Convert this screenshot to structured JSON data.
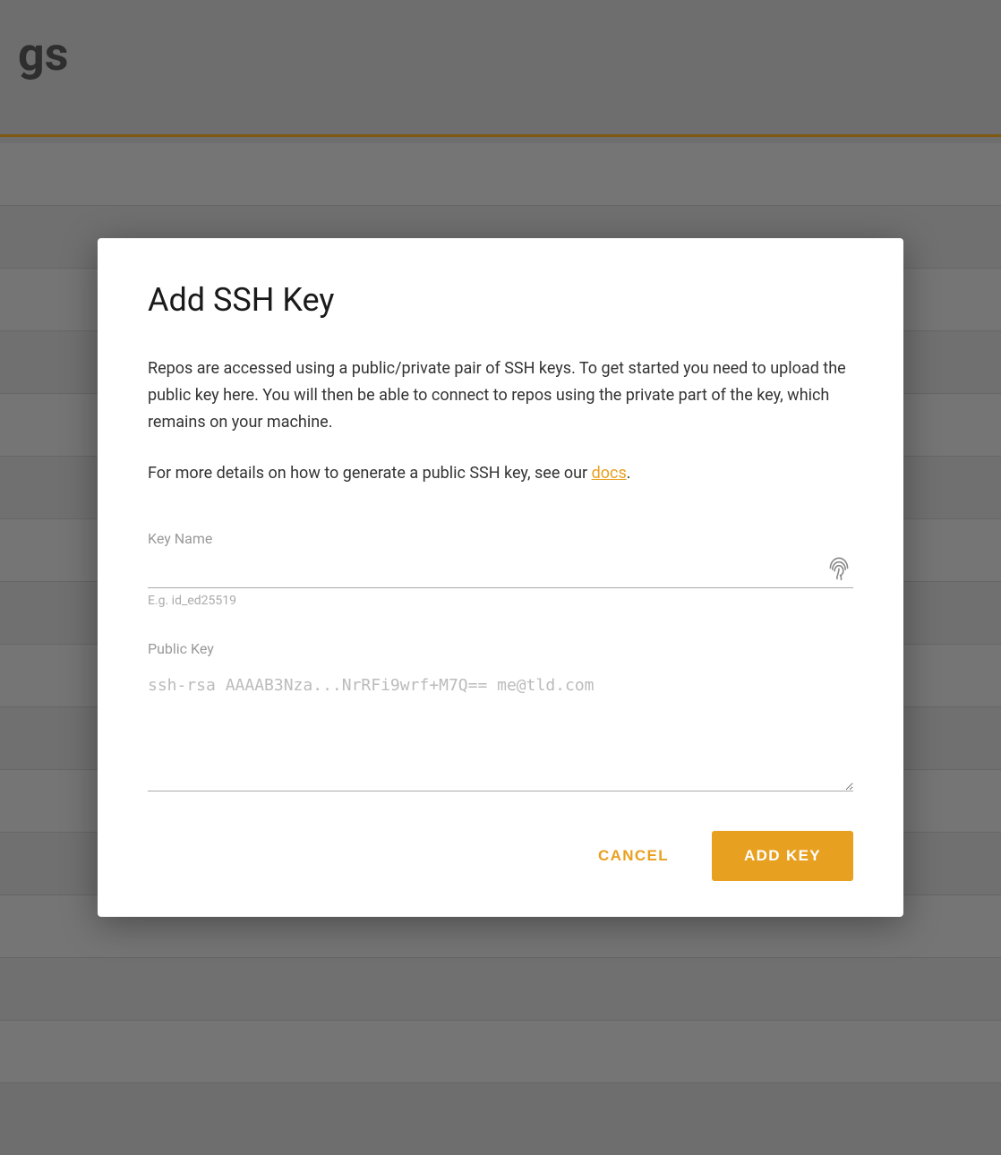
{
  "background": {
    "title": "gs",
    "accent_color": "#e8a020"
  },
  "modal": {
    "title": "Add SSH Key",
    "description_1": "Repos are accessed using a public/private pair of SSH keys. To get started you need to upload the public key here. You will then be able to connect to repos using the private part of the key, which remains on your machine.",
    "description_2_prefix": "For more details on how to generate a public SSH key, see our ",
    "docs_link_text": "docs",
    "description_2_suffix": ".",
    "key_name_label": "Key Name",
    "key_name_placeholder": "",
    "key_name_hint": "E.g. id_ed25519",
    "public_key_label": "Public Key",
    "public_key_placeholder": "ssh-rsa AAAAB3Nza...NrRFi9wrf+M7Q== me@tld.com",
    "cancel_label": "CANCEL",
    "add_key_label": "ADD KEY"
  }
}
